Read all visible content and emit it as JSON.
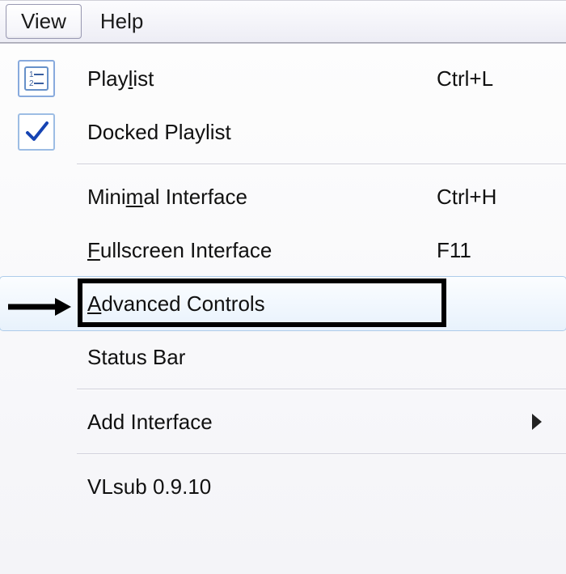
{
  "menubar": {
    "view": "View",
    "help": "Help"
  },
  "menu": {
    "playlist": {
      "label_pre": "Play",
      "label_u": "l",
      "label_post": "ist",
      "shortcut": "Ctrl+L"
    },
    "docked": {
      "label": "Docked Playlist"
    },
    "minimal": {
      "label_pre": "Mini",
      "label_u": "m",
      "label_post": "al Interface",
      "shortcut": "Ctrl+H"
    },
    "fullscreen": {
      "label_pre": "",
      "label_u": "F",
      "label_post": "ullscreen Interface",
      "shortcut": "F11"
    },
    "advanced": {
      "label_pre": "",
      "label_u": "A",
      "label_post": "dvanced Controls"
    },
    "statusbar": {
      "label": "Status Bar"
    },
    "addinterface": {
      "label": "Add Interface"
    },
    "vlsub": {
      "label": "VLsub 0.9.10"
    }
  }
}
